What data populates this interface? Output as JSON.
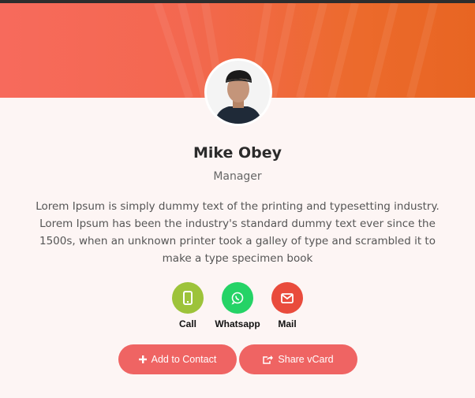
{
  "profile": {
    "name": "Mike Obey",
    "role": "Manager",
    "bio": "Lorem Ipsum is simply dummy text of the printing and typesetting industry. Lorem Ipsum has been the industry's standard dummy text ever since the 1500s, when an unknown printer took a galley of type and scrambled it to make a type specimen book"
  },
  "actions": {
    "call": {
      "label": "Call",
      "color": "#9dc33a",
      "icon": "phone-icon"
    },
    "whatsapp": {
      "label": "Whatsapp",
      "color": "#25d366",
      "icon": "whatsapp-icon"
    },
    "mail": {
      "label": "Mail",
      "color": "#e94b3c",
      "icon": "mail-icon"
    }
  },
  "buttons": {
    "add_contact": {
      "label": "Add to Contact",
      "icon": "plus-icon"
    },
    "share_vcard": {
      "label": "Share vCard",
      "icon": "share-icon"
    }
  },
  "colors": {
    "banner_start": "#f76a5c",
    "banner_end": "#e86522",
    "button": "#ef6463"
  }
}
